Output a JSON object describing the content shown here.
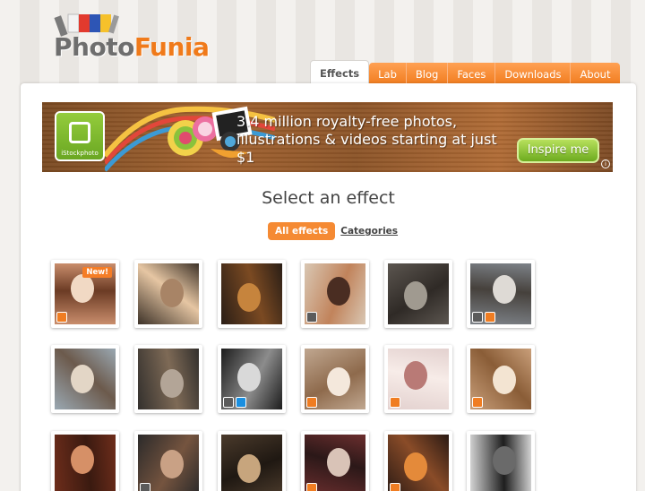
{
  "brand": {
    "photo": "Photo",
    "funia": "Funia"
  },
  "nav": {
    "tabs": [
      {
        "label": "Effects",
        "active": true
      },
      {
        "label": "Lab"
      },
      {
        "label": "Blog"
      },
      {
        "label": "Faces"
      },
      {
        "label": "Downloads"
      },
      {
        "label": "About"
      }
    ]
  },
  "banner": {
    "istock_label": "iStockphoto",
    "line1": "3.4 million royalty-free photos,",
    "line2": "illustrations & videos starting at just $1",
    "cta": "Inspire me",
    "info": "i"
  },
  "heading": "Select an effect",
  "filters": {
    "all": "All effects",
    "categories": "Categories"
  },
  "new_badge": "New!",
  "colors": {
    "accent": "#f58a33",
    "nav_orange": "#f07a1c",
    "green": "#7cb82f"
  },
  "thumbs": [
    {
      "badge": true,
      "icons": [
        "print"
      ]
    },
    {
      "icons": []
    },
    {
      "icons": []
    },
    {
      "icons": [
        "photo"
      ]
    },
    {
      "icons": []
    },
    {
      "icons": [
        "photo",
        "print"
      ]
    },
    {
      "icons": []
    },
    {
      "icons": []
    },
    {
      "icons": [
        "photo",
        "video"
      ]
    },
    {
      "icons": [
        "print"
      ]
    },
    {
      "icons": [
        "print"
      ]
    },
    {
      "icons": [
        "print"
      ]
    },
    {
      "icons": []
    },
    {
      "icons": [
        "photo"
      ]
    },
    {
      "icons": []
    },
    {
      "icons": [
        "print"
      ]
    },
    {
      "icons": [
        "print"
      ]
    },
    {
      "icons": []
    }
  ]
}
